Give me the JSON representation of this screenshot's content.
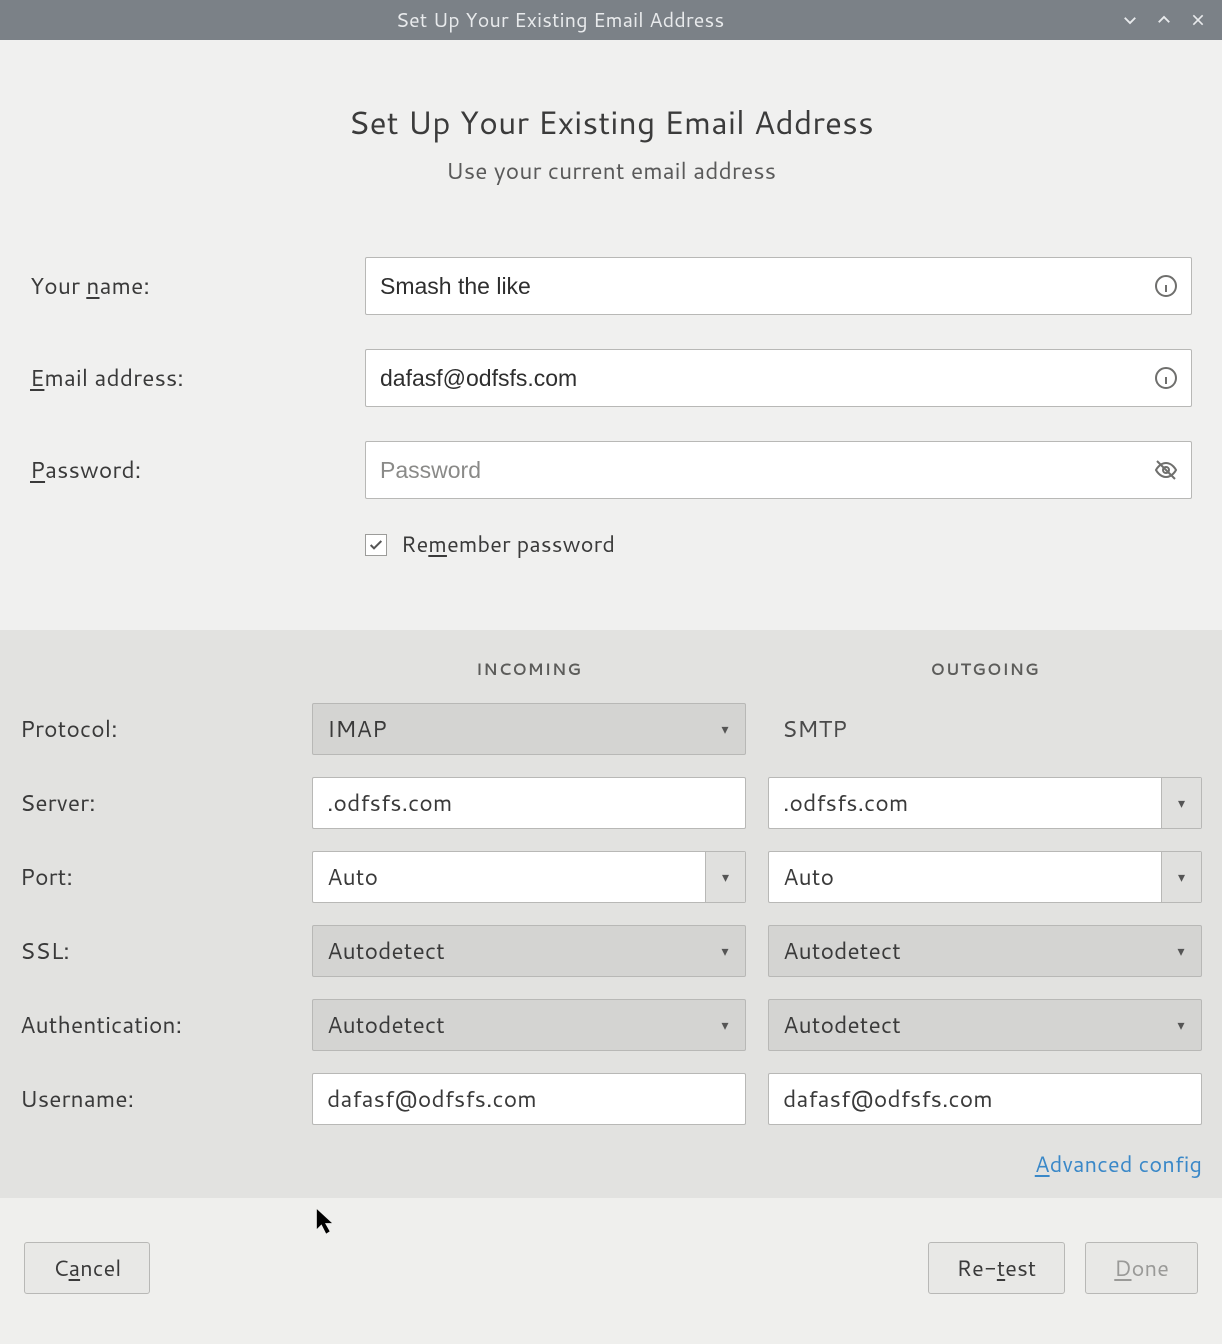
{
  "window": {
    "title": "Set Up Your Existing Email Address"
  },
  "header": {
    "title": "Set Up Your Existing Email Address",
    "subtitle": "Use your current email address"
  },
  "form": {
    "name_label_pre": "Your ",
    "name_label_u": "n",
    "name_label_post": "ame:",
    "name_value": "Smash the like",
    "email_label_u": "E",
    "email_label_post": "mail address:",
    "email_value": "dafasf@odfsfs.com",
    "password_label_u": "P",
    "password_label_post": "assword:",
    "password_value": "",
    "password_placeholder": "Password",
    "remember_pre": "Re",
    "remember_u": "m",
    "remember_post": "ember password",
    "remember_checked": true
  },
  "server": {
    "incoming_header": "INCOMING",
    "outgoing_header": "OUTGOING",
    "labels": {
      "protocol": "Protocol:",
      "server": "Server:",
      "port": "Port:",
      "ssl": "SSL:",
      "auth": "Authentication:",
      "username": "Username:"
    },
    "incoming": {
      "protocol": "IMAP",
      "server": ".odfsfs.com",
      "port": "Auto",
      "ssl": "Autodetect",
      "auth": "Autodetect",
      "username": "dafasf@odfsfs.com"
    },
    "outgoing": {
      "protocol": "SMTP",
      "server": ".odfsfs.com",
      "port": "Auto",
      "ssl": "Autodetect",
      "auth": "Autodetect",
      "username": "dafasf@odfsfs.com"
    },
    "advanced_u": "A",
    "advanced_post": "dvanced config"
  },
  "buttons": {
    "cancel_pre": "C",
    "cancel_u": "a",
    "cancel_post": "ncel",
    "retest_pre": "Re-",
    "retest_u": "t",
    "retest_post": "est",
    "done_u": "D",
    "done_post": "one"
  }
}
